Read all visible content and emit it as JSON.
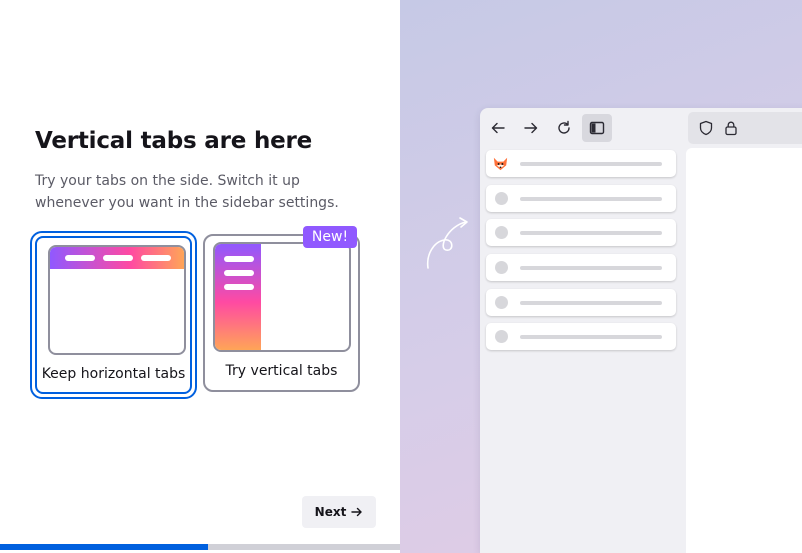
{
  "onboarding": {
    "title": "Vertical tabs are here",
    "subtitle": "Try your tabs on the side. Switch it up whenever you want in the sidebar settings.",
    "options": [
      {
        "label": "Keep horizontal tabs",
        "selected": true
      },
      {
        "label": "Try vertical tabs",
        "selected": false,
        "badge": "New!"
      }
    ],
    "next_label": "Next",
    "progress": 0.52
  },
  "colors": {
    "accent": "#0060df",
    "badge": "#9059ff",
    "gradient": [
      "#9059ff",
      "#ff4aa2",
      "#ffa557"
    ]
  },
  "illustration": {
    "toolbar_icons": [
      "back-arrow-icon",
      "forward-arrow-icon",
      "reload-icon",
      "sidebar-icon",
      "shield-icon",
      "lock-icon"
    ],
    "tab_count": 6,
    "first_tab_icon": "fox-favicon-icon"
  }
}
